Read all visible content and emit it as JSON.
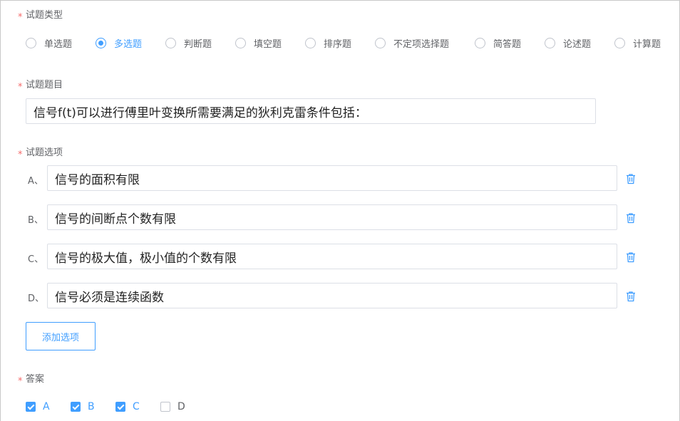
{
  "question_type": {
    "label": "试题类型",
    "options": [
      "单选题",
      "多选题",
      "判断题",
      "填空题",
      "排序题",
      "不定项选择题",
      "简答题",
      "论述题",
      "计算题"
    ],
    "selected": "多选题"
  },
  "question_title": {
    "label": "试题题目",
    "value": "信号f(t)可以进行傅里叶变换所需要满足的狄利克雷条件包括："
  },
  "question_options": {
    "label": "试题选项",
    "items": [
      {
        "letter": "A、",
        "value": "信号的面积有限"
      },
      {
        "letter": "B、",
        "value": "信号的间断点个数有限"
      },
      {
        "letter": "C、",
        "value": "信号的极大值，极小值的个数有限"
      },
      {
        "letter": "D、",
        "value": "信号必须是连续函数"
      }
    ],
    "add_button": "添加选项",
    "delete_icon": "trash-icon"
  },
  "answer": {
    "label": "答案",
    "choices": [
      {
        "label": "A",
        "checked": true
      },
      {
        "label": "B",
        "checked": true
      },
      {
        "label": "C",
        "checked": true
      },
      {
        "label": "D",
        "checked": false
      }
    ]
  },
  "required_mark": "*",
  "colors": {
    "accent": "#409eff",
    "required": "#f56c6c",
    "border": "#dcdfe6",
    "text": "#606266"
  }
}
